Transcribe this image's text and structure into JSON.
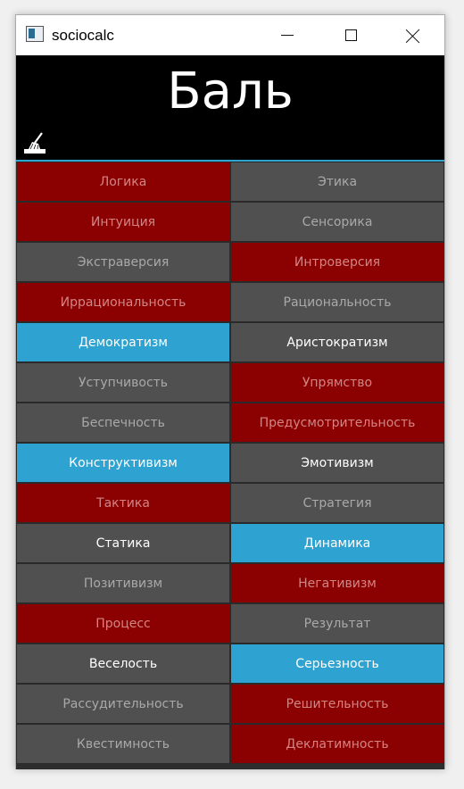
{
  "window": {
    "title": "sociocalc"
  },
  "display": {
    "value": "Баль"
  },
  "icons": {
    "app": "app-icon",
    "clear": "broom-icon"
  },
  "colors": {
    "red": "#8b0000",
    "gray": "#505050",
    "blue": "#2ea2d0",
    "accent": "#2fa3d0"
  },
  "buttons": [
    {
      "label": "Логика",
      "state": "red"
    },
    {
      "label": "Этика",
      "state": "gray"
    },
    {
      "label": "Интуиция",
      "state": "red"
    },
    {
      "label": "Сенсорика",
      "state": "gray"
    },
    {
      "label": "Экстраверсия",
      "state": "gray"
    },
    {
      "label": "Интроверсия",
      "state": "red"
    },
    {
      "label": "Иррациональность",
      "state": "red"
    },
    {
      "label": "Рациональность",
      "state": "gray"
    },
    {
      "label": "Демократизм",
      "state": "blue"
    },
    {
      "label": "Аристократизм",
      "state": "grayw"
    },
    {
      "label": "Уступчивость",
      "state": "gray"
    },
    {
      "label": "Упрямство",
      "state": "red"
    },
    {
      "label": "Беспечность",
      "state": "gray"
    },
    {
      "label": "Предусмотрительность",
      "state": "red"
    },
    {
      "label": "Конструктивизм",
      "state": "blue"
    },
    {
      "label": "Эмотивизм",
      "state": "grayw"
    },
    {
      "label": "Тактика",
      "state": "red"
    },
    {
      "label": "Стратегия",
      "state": "gray"
    },
    {
      "label": "Статика",
      "state": "grayw"
    },
    {
      "label": "Динамика",
      "state": "blue"
    },
    {
      "label": "Позитивизм",
      "state": "gray"
    },
    {
      "label": "Негативизм",
      "state": "red"
    },
    {
      "label": "Процесс",
      "state": "red"
    },
    {
      "label": "Результат",
      "state": "gray"
    },
    {
      "label": "Веселость",
      "state": "grayw"
    },
    {
      "label": "Серьезность",
      "state": "blue"
    },
    {
      "label": "Рассудительность",
      "state": "gray"
    },
    {
      "label": "Решительность",
      "state": "red"
    },
    {
      "label": "Квестимность",
      "state": "gray"
    },
    {
      "label": "Деклатимность",
      "state": "red"
    }
  ]
}
